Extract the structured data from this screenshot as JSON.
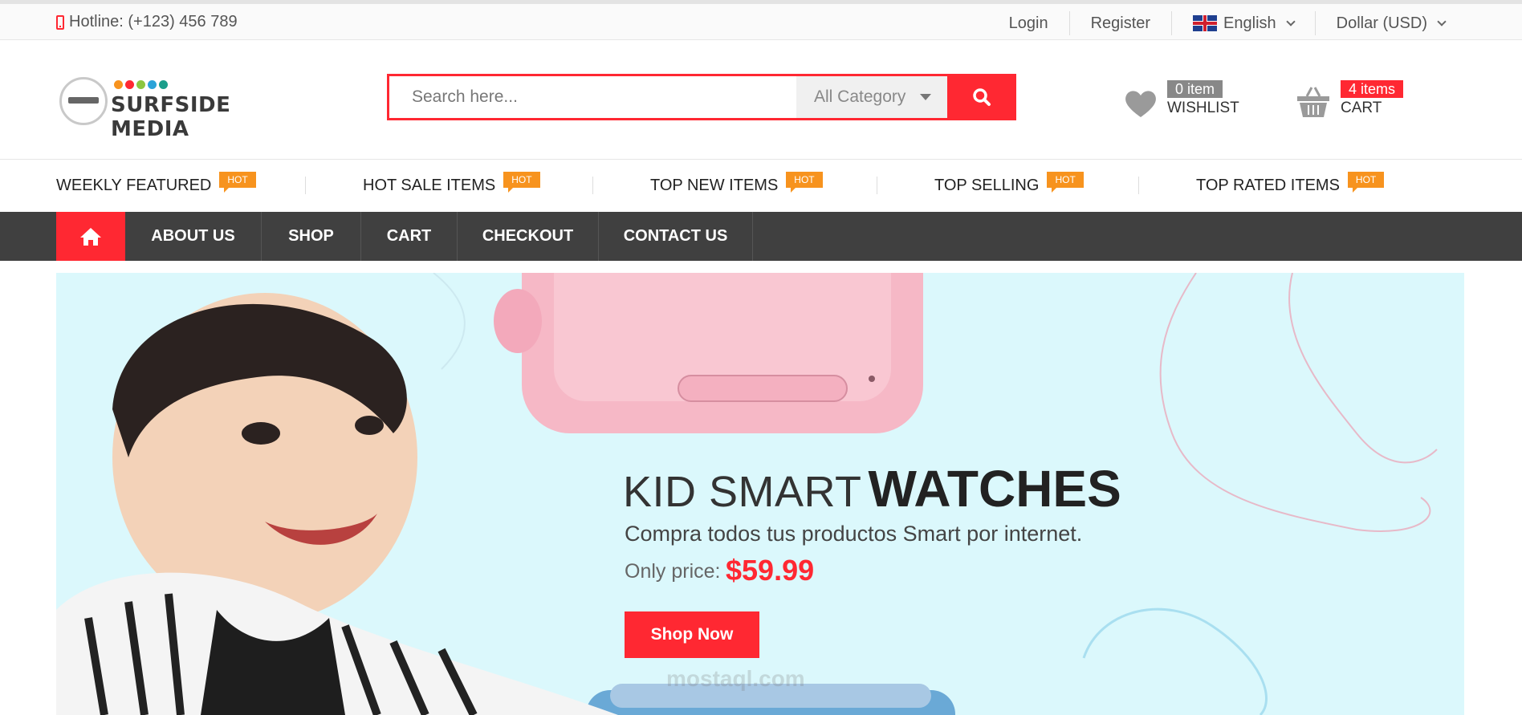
{
  "topbar": {
    "hotline": "Hotline: (+123) 456 789",
    "links": [
      "Login",
      "Register"
    ],
    "language": "English",
    "currency": "Dollar (USD)"
  },
  "header": {
    "logo_text": "SURFSIDE MEDIA",
    "logo_dot_colors": [
      "#f7931e",
      "#ff2832",
      "#8cc63f",
      "#2aa3d8",
      "#1b9e8b"
    ],
    "search_placeholder": "Search here...",
    "category_selected": "All Category",
    "wishlist_count": "0 item",
    "wishlist_label": "WISHLIST",
    "cart_count": "4 items",
    "cart_label": "CART"
  },
  "categories": [
    {
      "label": "WEEKLY FEATURED",
      "badge": "HOT"
    },
    {
      "label": "HOT SALE ITEMS",
      "badge": "HOT"
    },
    {
      "label": "TOP NEW ITEMS",
      "badge": "HOT"
    },
    {
      "label": "TOP SELLING",
      "badge": "HOT"
    },
    {
      "label": "TOP RATED ITEMS",
      "badge": "HOT"
    }
  ],
  "nav": {
    "items": [
      "ABOUT US",
      "SHOP",
      "CART",
      "CHECKOUT",
      "CONTACT US"
    ]
  },
  "banner": {
    "title_light": "KID SMART",
    "title_bold": "WATCHES",
    "subtitle": "Compra todos tus productos Smart por internet.",
    "price_label": "Only price:",
    "price": "$59.99",
    "button": "Shop Now"
  },
  "watermark": "mostaql.com",
  "colors": {
    "accent": "#ff2832",
    "badge_hot": "#f7931e",
    "nav_bg": "#404040",
    "banner_bg": "#dbf8fc"
  },
  "icons": [
    "phone-icon",
    "flag-uk-icon",
    "chevron-down-icon",
    "search-icon",
    "heart-icon",
    "basket-icon",
    "home-icon"
  ]
}
